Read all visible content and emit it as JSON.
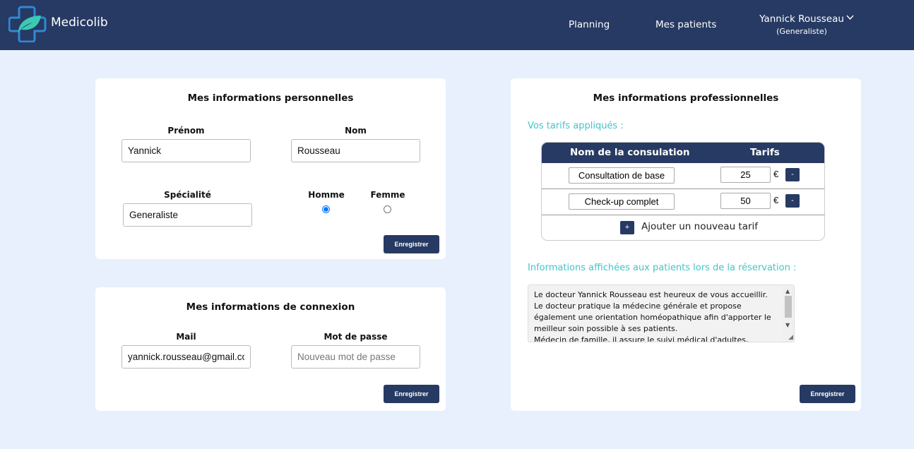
{
  "header": {
    "brand": "Medicolib",
    "nav": {
      "planning": "Planning",
      "patients": "Mes patients"
    },
    "user": {
      "name": "Yannick Rousseau",
      "role": "(Generaliste)"
    },
    "colors": {
      "bar": "#263a63",
      "accent": "#44c4c7"
    }
  },
  "personal": {
    "title": "Mes informations personnelles",
    "firstname_label": "Prénom",
    "firstname_value": "Yannick",
    "lastname_label": "Nom",
    "lastname_value": "Rousseau",
    "specialty_label": "Spécialité",
    "specialty_value": "Generaliste",
    "gender_male": "Homme",
    "gender_female": "Femme",
    "gender_selected": "Homme",
    "save_label": "Enregistrer"
  },
  "connexion": {
    "title": "Mes informations de connexion",
    "mail_label": "Mail",
    "mail_value": "yannick.rousseau@gmail.com",
    "password_label": "Mot de passe",
    "password_placeholder": "Nouveau mot de passe",
    "save_label": "Enregistrer"
  },
  "professional": {
    "title": "Mes informations professionnelles",
    "tarifs_heading": "Vos tarifs appliqués :",
    "table_headers": {
      "name": "Nom de la consulation",
      "tarif": "Tarifs"
    },
    "tarifs": [
      {
        "name": "Consultation de base",
        "price": "25",
        "currency": "€",
        "remove": "-"
      },
      {
        "name": "Check-up complet",
        "price": "50",
        "currency": "€",
        "remove": "-"
      }
    ],
    "add_button": "+",
    "add_label": "Ajouter un nouveau tarif",
    "info_heading": "Informations affichées aux patients lors de la réservation :",
    "info_text": "Le docteur Yannick Rousseau est heureux de vous accueillir.\nLe docteur pratique la médecine générale et propose également une orientation homéopathique afin d'apporter le meilleur soin possible à ses patients.\nMédecin de famille, il assure le suivi médical d'adultes, enfants",
    "save_label": "Enregistrer"
  }
}
